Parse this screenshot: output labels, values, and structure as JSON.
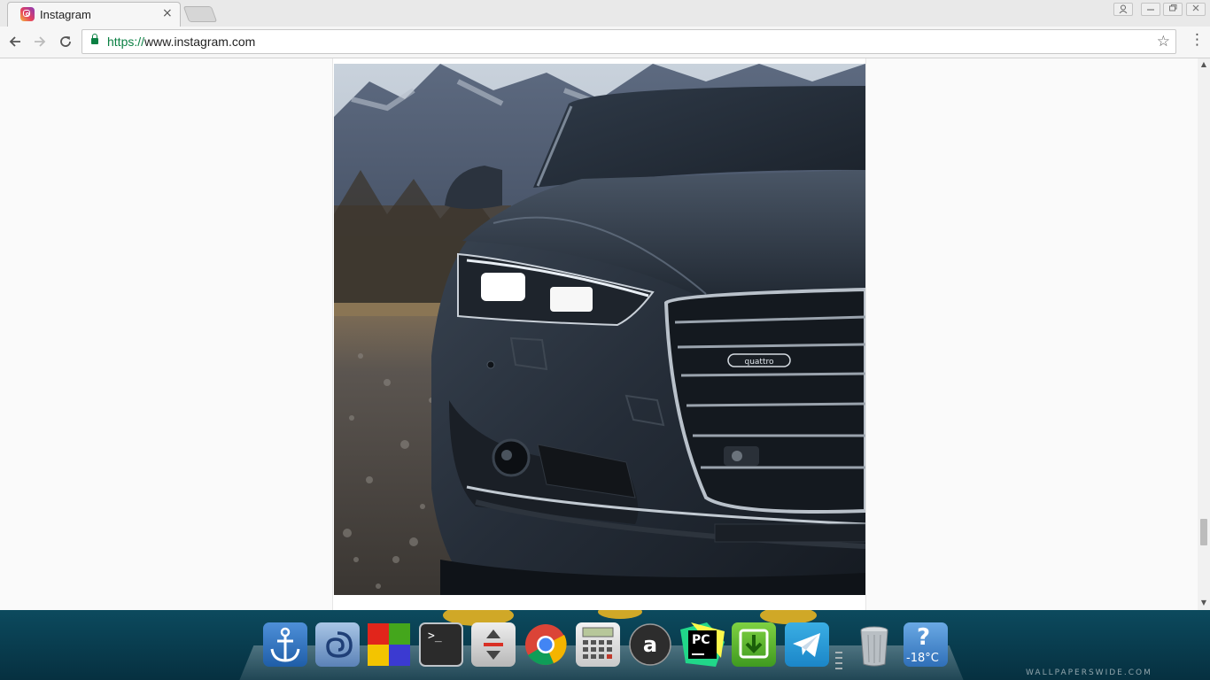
{
  "browser": {
    "tab": {
      "title": "Instagram",
      "favicon": "instagram-icon",
      "close": "×"
    },
    "address": {
      "scheme": "https://",
      "host": "www.instagram.com"
    },
    "icons": [
      "back-icon",
      "forward-icon",
      "reload-icon",
      "lock-icon",
      "star-icon",
      "menu-icon"
    ]
  },
  "post": {
    "image_description": "dark grey sedan front headlight and grille, mountains behind",
    "emblem": "quattro"
  },
  "dock": {
    "items": [
      "anchor-icon",
      "swirl-app-icon",
      "color-blocks-icon",
      "terminal-icon",
      "transfer-icon",
      "chrome-icon",
      "calculator-icon",
      "amazon-icon",
      "pycharm-icon",
      "download-icon",
      "telegram-icon",
      "trash-icon",
      "weather-icon"
    ],
    "terminal_prompt": ">_",
    "pycharm_label": "PC",
    "weather_temp": "-18°C",
    "weather_glyph": "?"
  },
  "watermark": "WALLPAPERSWIDE.COM"
}
